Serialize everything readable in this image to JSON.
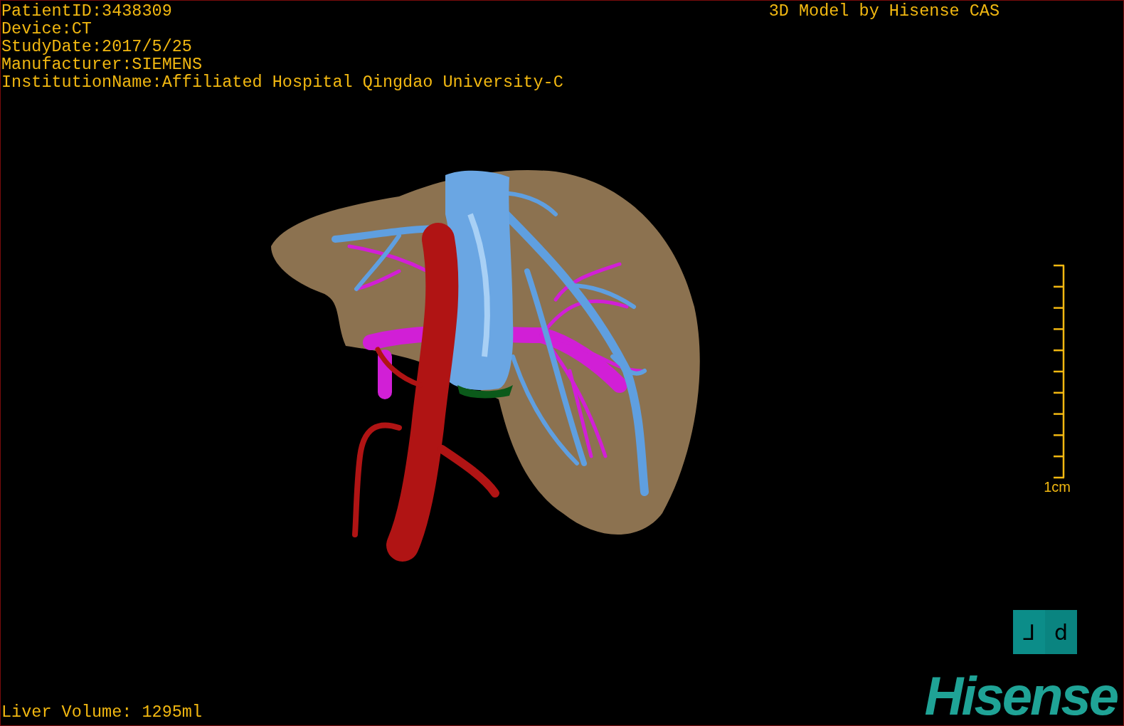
{
  "patient_info": [
    "PatientID:3438309",
    "Device:CT",
    "StudyDate:2017/5/25",
    "Manufacturer:SIEMENS",
    "InstitutionName:Affiliated Hospital Qingdao University-C"
  ],
  "title": "3D Model by Hisense CAS",
  "scale_bar": {
    "label": "1cm"
  },
  "orientation_cube": {
    "faces": [
      "⅃",
      "d"
    ]
  },
  "liver_volume": "Liver Volume: 1295ml",
  "logo": "Hisense"
}
